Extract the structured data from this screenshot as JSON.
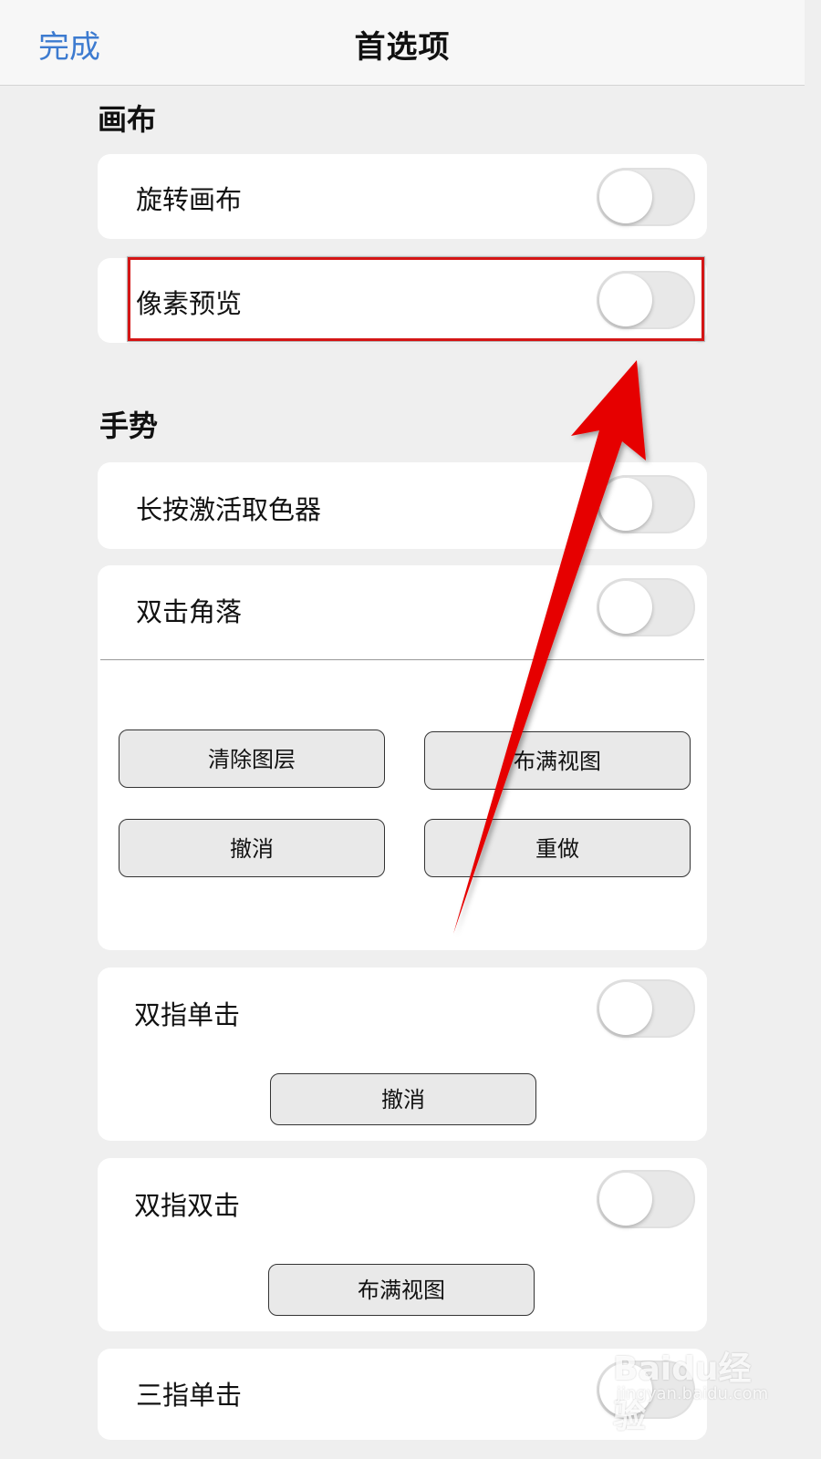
{
  "nav": {
    "done_label": "完成",
    "title": "首选项"
  },
  "sections": {
    "canvas": {
      "title": "画布",
      "rows": [
        {
          "label": "旋转画布",
          "toggle_on": false
        },
        {
          "label": "像素预览",
          "toggle_on": false
        }
      ]
    },
    "gestures": {
      "title": "手势",
      "long_press": {
        "label": "长按激活取色器",
        "toggle_on": false
      },
      "double_tap_corner": {
        "label": "双击角落",
        "toggle_on": false,
        "buttons": [
          "清除图层",
          "布满视图",
          "撤消",
          "重做"
        ]
      },
      "two_finger_tap": {
        "label": "双指单击",
        "toggle_on": false,
        "action": "撤消"
      },
      "two_finger_double_tap": {
        "label": "双指双击",
        "toggle_on": false,
        "action": "布满视图"
      },
      "three_finger_tap": {
        "label": "三指单击",
        "toggle_on": false
      }
    }
  },
  "annotation": {
    "highlight_color": "#d41515",
    "arrow_color": "#e60000"
  },
  "watermark": {
    "brand": "Baidu经验",
    "url": "jingyan.baidu.com"
  },
  "colors": {
    "accent": "#3d7bd0",
    "background": "#efefef",
    "card": "#ffffff"
  }
}
